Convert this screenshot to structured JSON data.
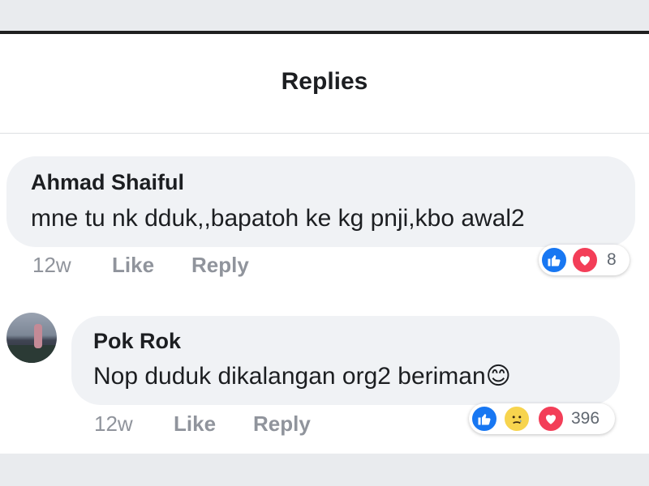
{
  "header": {
    "title": "Replies"
  },
  "comments": [
    {
      "author": "Ahmad Shaiful",
      "text": "mne tu nk dduk,,bapatoh ke kg pnji,kbo awal2",
      "time": "12w",
      "like_label": "Like",
      "reply_label": "Reply",
      "reactions": {
        "types": [
          "like",
          "love"
        ],
        "count": "8"
      }
    },
    {
      "author": "Pok Rok",
      "text": "Nop duduk dikalangan org2 beriman😊",
      "time": "12w",
      "like_label": "Like",
      "reply_label": "Reply",
      "reactions": {
        "types": [
          "like",
          "sad",
          "love"
        ],
        "count": "396"
      }
    }
  ],
  "colors": {
    "like": "#1877f2",
    "love": "#f33e58",
    "sad": "#f7d44e",
    "bubble": "#f0f2f5",
    "meta_text": "#90949c"
  }
}
